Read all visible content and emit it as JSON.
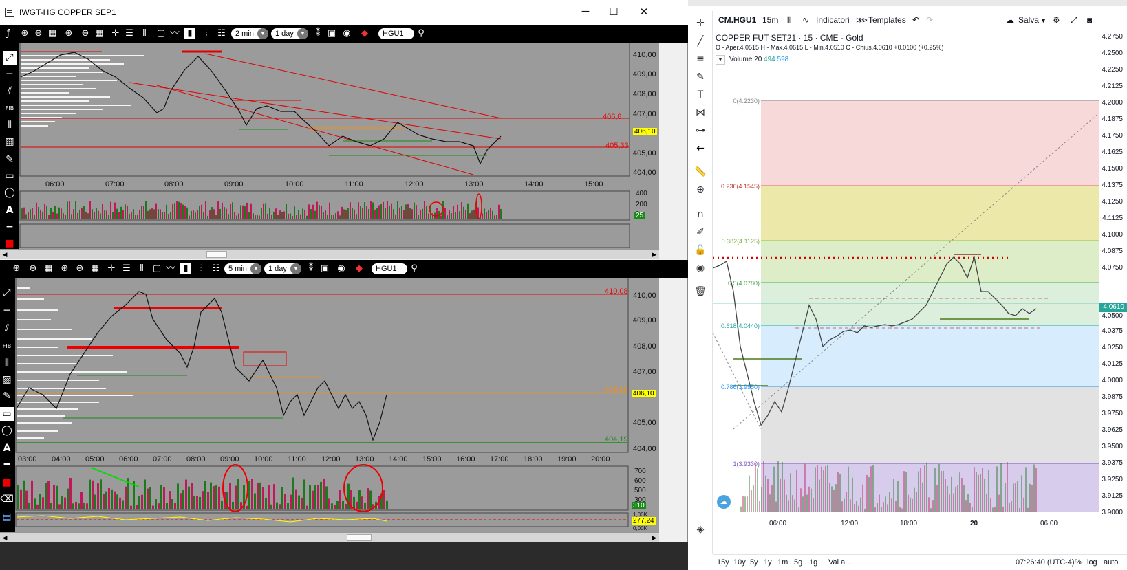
{
  "window": {
    "title": "IWGT-HG COPPER SEP1",
    "controls": {
      "minimize": "─",
      "maximize": "☐",
      "close": "✕"
    }
  },
  "top_chart": {
    "toolbar": {
      "interval": "2 min",
      "period": "1 day",
      "symbol": "HGU1"
    },
    "y_labels": [
      "410,00",
      "409,00",
      "408,00",
      "407,00",
      "406,00",
      "405,00",
      "404,00"
    ],
    "x_labels": [
      "06:00",
      "07:00",
      "08:00",
      "09:00",
      "10:00",
      "11:00",
      "12:00",
      "13:00",
      "14:00",
      "15:00"
    ],
    "level_labels": [
      "406,8",
      "405,33"
    ],
    "last_price": "406,10",
    "volume_labels": [
      "400",
      "200",
      "0"
    ],
    "volume_tag": "25"
  },
  "bottom_chart": {
    "toolbar": {
      "interval": "5 min",
      "period": "1 day",
      "symbol": "HGU1"
    },
    "y_labels": [
      "410,00",
      "409,00",
      "408,00",
      "407,00",
      "406,00",
      "405,00",
      "404,00"
    ],
    "x_labels": [
      "03:00",
      "04:00",
      "05:00",
      "06:00",
      "07:00",
      "08:00",
      "09:00",
      "10:00",
      "11:00",
      "12:00",
      "13:00",
      "14:00",
      "15:00",
      "16:00",
      "17:00",
      "18:00",
      "19:00",
      "20:00"
    ],
    "level_labels": [
      "410,08",
      "406,10",
      "404,19"
    ],
    "last_price": "406,10",
    "volume_labels": [
      "700",
      "600",
      "500",
      "300",
      "310"
    ],
    "osc_labels": [
      "1,00K",
      "277,24",
      "0,00K"
    ]
  },
  "tradingview": {
    "header": {
      "symbol": "CM.HGU1",
      "interval": "15m",
      "indicators": "Indicatori",
      "templates": "Templates",
      "save": "Salva"
    },
    "title": "COPPER FUT SET21 · 15 · CME - Gold",
    "ohlc": "O - Aper.4.0515  H - Max.4.0615  L - Min.4.0510  C - Chius.4.0610 +0.0100 (+0.25%)",
    "volume_legend": "Volume 20",
    "volume_values": [
      "494",
      "598"
    ],
    "fib_labels": [
      "0(4.2230)",
      "0.236(4.1545)",
      "0.382(4.1125)",
      "0.5(4.0780)",
      "0.618(4.0440)",
      "0.786(3.9950)",
      "1(3.9330)"
    ],
    "price_labels": [
      "4.2750",
      "4.2500",
      "4.2250",
      "4.2125",
      "4.2000",
      "4.1875",
      "4.1750",
      "4.1625",
      "4.1500",
      "4.1375",
      "4.1250",
      "4.1125",
      "4.1000",
      "4.0875",
      "4.0750",
      "4.0610",
      "4.0500",
      "4.0375",
      "4.0250",
      "4.0125",
      "4.0000",
      "3.9875",
      "3.9750",
      "3.9625",
      "3.9500",
      "3.9375",
      "3.9250",
      "3.9125",
      "3.9000"
    ],
    "time_labels": [
      "06:00",
      "12:00",
      "18:00",
      "20",
      "06:00"
    ],
    "bottom": {
      "ranges": [
        "15y",
        "10y",
        "5y",
        "1y",
        "1m",
        "5g",
        "1g"
      ],
      "goto": "Vai a...",
      "clock": "07:26:40 (UTC-4)",
      "percent": "%",
      "log": "log",
      "auto": "auto"
    },
    "colors": {
      "fib_0": "#e06666",
      "fib_236": "#f0a64a",
      "fib_382": "#8bc34a",
      "fib_5": "#4caf50",
      "fib_618": "#26a69a",
      "fib_786": "#2196f3",
      "fib_1": "#7e57c2"
    }
  }
}
